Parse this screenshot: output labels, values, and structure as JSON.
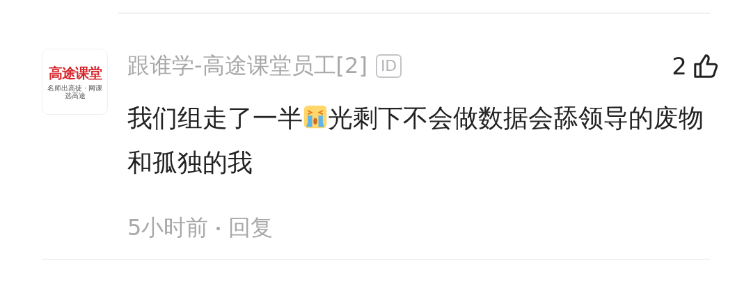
{
  "comment": {
    "avatar": {
      "brand": "高途课堂",
      "slogan": "名师出高徒 · 网课选高途"
    },
    "author": "跟谁学-高途课堂员工[2]",
    "id_badge": "ID",
    "likes": "2",
    "text_before_emoji": "我们组走了一半",
    "text_after_emoji": "光剩下不会做数据会舔领导的废物和孤独的我",
    "time": "5小时前",
    "reply": "回复"
  }
}
